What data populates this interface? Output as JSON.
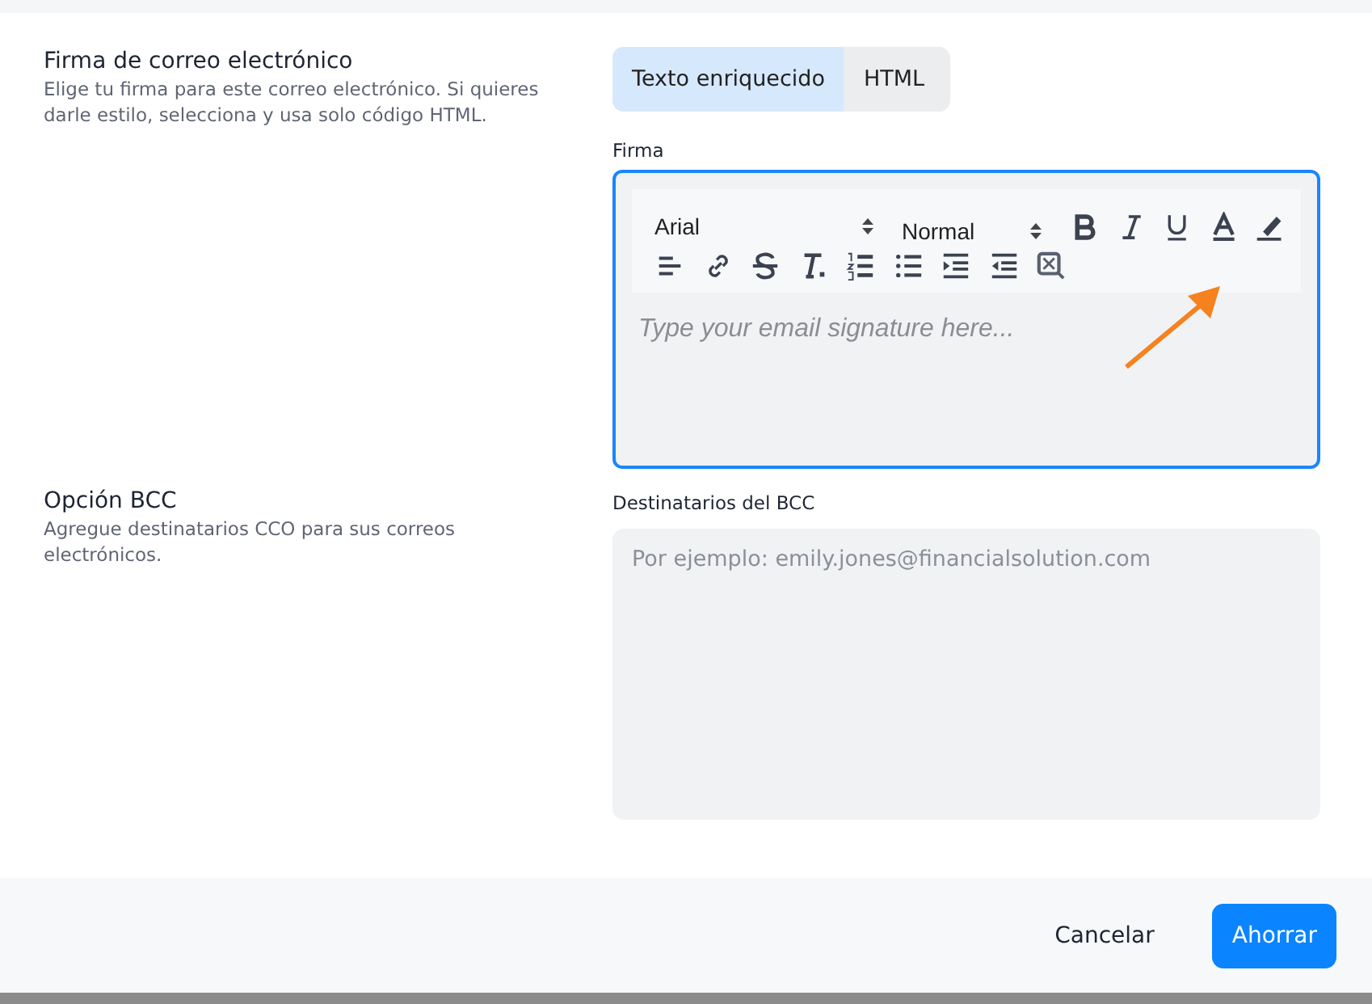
{
  "signature_section": {
    "title": "Firma de correo electrónico",
    "description": "Elige tu firma para este correo electrónico. Si quieres darle estilo, selecciona y usa solo código HTML.",
    "tabs": [
      {
        "label": "Texto enriquecido",
        "selected": true
      },
      {
        "label": "HTML",
        "selected": false
      }
    ],
    "field_label": "Firma",
    "editor": {
      "focused": true,
      "font": "Arial",
      "size": "Normal",
      "placeholder": "Type your email signature here..."
    }
  },
  "bcc_section": {
    "title": "Opción BCC",
    "description": "Agregue destinatarios CCO para sus correos electrónicos.",
    "field_label": "Destinatarios del BCC",
    "placeholder": "Por ejemplo: emily.jones@financialsolution.com"
  },
  "footer": {
    "buttons": [
      {
        "label": "Cancelar",
        "kind": "secondary"
      },
      {
        "label": "Ahorrar",
        "kind": "primary"
      }
    ]
  }
}
